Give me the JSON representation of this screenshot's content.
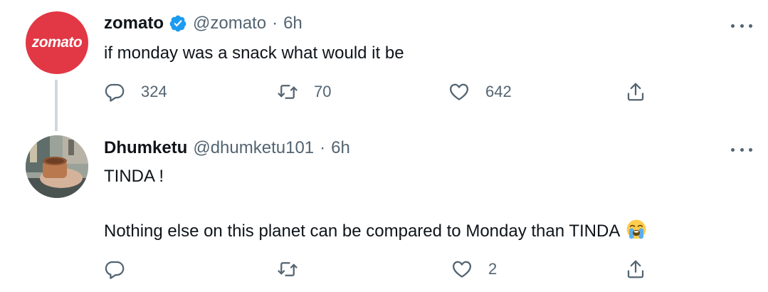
{
  "tweets": [
    {
      "author_name": "zomato",
      "handle": "@zomato",
      "separator": "·",
      "time": "6h",
      "avatar_text": "zomato",
      "text_lines": [
        "if monday was a snack what would it be"
      ],
      "counts": {
        "reply": "324",
        "retweet": "70",
        "like": "642"
      }
    },
    {
      "author_name": "Dhumketu",
      "handle": "@dhumketu101",
      "separator": "·",
      "time": "6h",
      "text_lines": [
        "TINDA !",
        "Nothing else on this planet can be compared to Monday than TINDA"
      ],
      "counts": {
        "reply": "",
        "retweet": "",
        "like": "2"
      }
    }
  ],
  "icons": {
    "verified": "verified-badge-icon",
    "reply": "reply-icon",
    "retweet": "retweet-icon",
    "like": "heart-icon",
    "share": "share-icon",
    "more": "more-icon",
    "emoji": "loudly-crying-face-emoji"
  },
  "colors": {
    "zomato_red": "#e23744",
    "verified_blue": "#1d9bf0",
    "muted_text": "#536471"
  }
}
